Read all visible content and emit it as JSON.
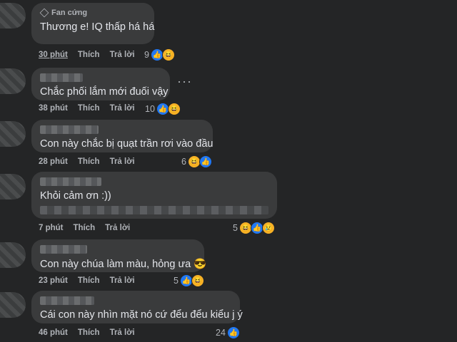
{
  "comments": [
    {
      "badge": "Fan cứng",
      "text": "Thương e! IQ thấp há há",
      "time": "30 phút",
      "like": "Thích",
      "reply": "Trả lời",
      "count": "9",
      "reactions": [
        "like-icon",
        "haha-icon"
      ]
    },
    {
      "text": "Chắc phối lắm mới đuối vậy",
      "time": "38 phút",
      "like": "Thích",
      "reply": "Trả lời",
      "count": "10",
      "reactions": [
        "like-icon",
        "haha-icon"
      ],
      "more": "···"
    },
    {
      "text": "Con này chắc bị quạt trần rơi vào đầu",
      "time": "28 phút",
      "like": "Thích",
      "reply": "Trả lời",
      "count": "6",
      "reactions": [
        "haha-icon",
        "like-icon"
      ]
    },
    {
      "text": "Khỏi cảm ơn :))",
      "time": "7 phút",
      "like": "Thích",
      "reply": "Trả lời",
      "count": "5",
      "reactions": [
        "haha-icon",
        "like-icon",
        "sad-icon"
      ]
    },
    {
      "text": "Con này chúa làm màu, hỏng ưa 😎",
      "time": "23 phút",
      "like": "Thích",
      "reply": "Trả lời",
      "count": "5",
      "reactions": [
        "like-icon",
        "haha-icon"
      ]
    },
    {
      "text": "Cái con này nhìn mặt nó cứ đểu đểu kiểu j ý",
      "time": "46 phút",
      "like": "Thích",
      "reply": "Trả lời",
      "count": "24",
      "reactions": [
        "like-icon"
      ]
    }
  ]
}
